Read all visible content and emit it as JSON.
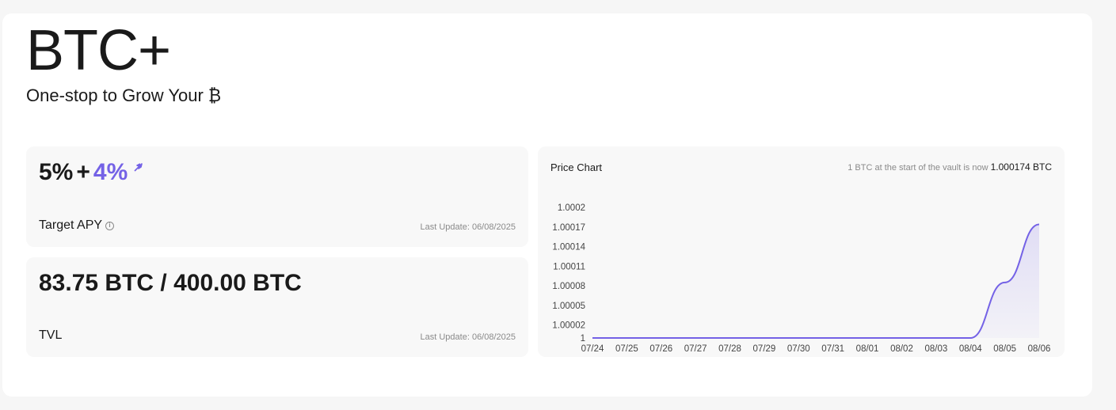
{
  "header": {
    "title": "BTC+",
    "subtitle": "One-stop to Grow Your ₿"
  },
  "apy_card": {
    "base": "5%",
    "plus": "+",
    "boost": "4%",
    "label": "Target APY",
    "last_update": "Last Update: 06/08/2025"
  },
  "tvl_card": {
    "value": "83.75 BTC / 400.00 BTC",
    "label": "TVL",
    "last_update": "Last Update: 06/08/2025"
  },
  "chart_card": {
    "title": "Price Chart",
    "note_prefix": "1 BTC at the start of the vault is now",
    "note_value": "1.000174 BTC"
  },
  "colors": {
    "accent": "#7462e6",
    "line": "#7462e6"
  },
  "chart_data": {
    "type": "area",
    "title": "Price Chart",
    "xlabel": "",
    "ylabel": "",
    "x": [
      "07/24",
      "07/25",
      "07/26",
      "07/27",
      "07/28",
      "07/29",
      "07/30",
      "07/31",
      "08/01",
      "08/02",
      "08/03",
      "08/04",
      "08/05",
      "08/06"
    ],
    "values": [
      1,
      1,
      1,
      1,
      1,
      1,
      1,
      1,
      1,
      1,
      1,
      1,
      1.000085,
      1.000174
    ],
    "y_ticks": [
      "1",
      "1.00002",
      "1.00005",
      "1.00008",
      "1.00011",
      "1.00014",
      "1.00017",
      "1.0002"
    ],
    "ylim": [
      1,
      1.0002
    ],
    "grid": false
  }
}
